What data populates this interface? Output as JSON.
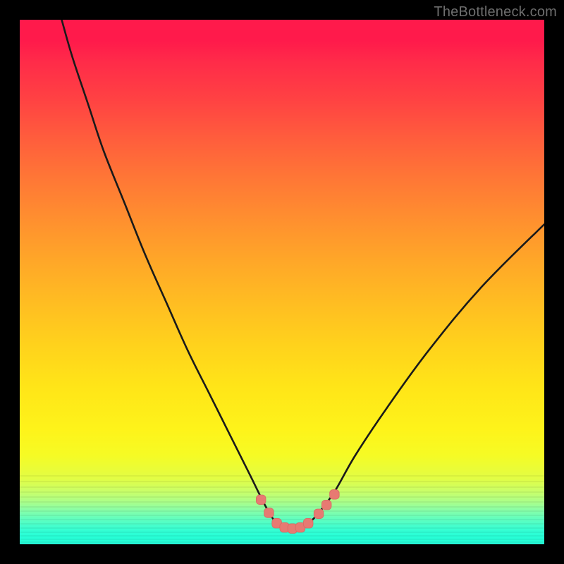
{
  "watermark": {
    "text": "TheBottleneck.com"
  },
  "palette": {
    "page_bg": "#000000",
    "curve_stroke": "#1a1a1a",
    "marker_fill": "#e77a72",
    "marker_stroke": "#d96a63",
    "gradient_stops": [
      "#ff1a4b",
      "#ff4143",
      "#ff7636",
      "#ffa728",
      "#ffd21c",
      "#fef31a",
      "#e2fd45",
      "#a9fe8b",
      "#45fecc",
      "#25fed7"
    ]
  },
  "chart_data": {
    "type": "line",
    "title": "",
    "xlabel": "",
    "ylabel": "",
    "xlim": [
      0,
      100
    ],
    "ylim": [
      0,
      100
    ],
    "grid": false,
    "legend": false,
    "notes": "No axis ticks or numeric labels are shown in the image; x and y values are estimated on an implied 0–100 scale (0 at bottom-left). The background is a vertical red→yellow→green gradient. The main series is a black curve; a short cluster of salmon dots lies along the curve near its minimum.",
    "series": [
      {
        "name": "bottleneck-curve",
        "color": "#1a1a1a",
        "type": "line",
        "x": [
          8,
          10,
          13,
          16,
          20,
          24,
          28,
          32,
          36,
          40,
          44,
          47,
          49,
          51,
          53,
          55,
          57,
          60,
          64,
          70,
          78,
          88,
          100
        ],
        "y": [
          100,
          93,
          84,
          75,
          65,
          55,
          46,
          37,
          29,
          21,
          13,
          7,
          4,
          3,
          3,
          4,
          6,
          10,
          17,
          26,
          37,
          49,
          61
        ]
      },
      {
        "name": "highlight-dots",
        "color": "#e77a72",
        "type": "scatter",
        "x": [
          46,
          47.5,
          49,
          50.5,
          52,
          53.5,
          55,
          57,
          58.5,
          60
        ],
        "y": [
          8.5,
          6,
          4,
          3.2,
          3,
          3.2,
          4,
          5.8,
          7.5,
          9.5
        ]
      }
    ]
  }
}
